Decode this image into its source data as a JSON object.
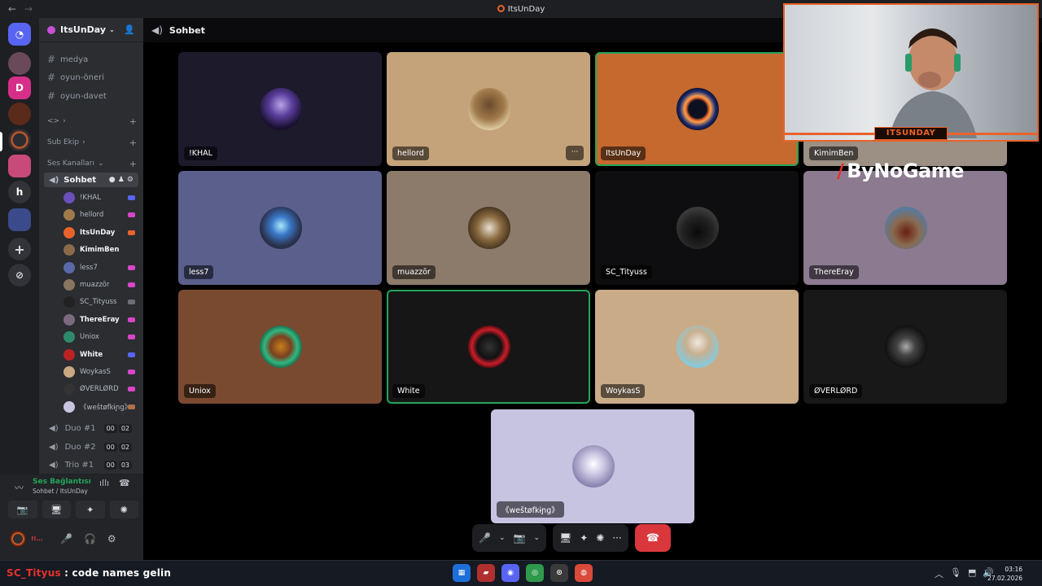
{
  "window": {
    "title": "ItsUnDay",
    "back": "←",
    "forward": "→"
  },
  "guild": {
    "name": "ItsUnDay",
    "chevron": "⌄",
    "invite_icon": "👤"
  },
  "channels": {
    "text": [
      {
        "name": "medya"
      },
      {
        "name": "oyun-öneri"
      },
      {
        "name": "oyun-davet"
      }
    ],
    "collapsed_cat": "<>",
    "sub_ekip": "Sub Ekip",
    "voice_cat": "Ses Kanalları",
    "active_voice": "Sohbet",
    "members": [
      {
        "name": "!KHAL",
        "color": "#6b4fb8",
        "bold": false,
        "tag": "#5865f2"
      },
      {
        "name": "hellord",
        "color": "#a07a4a",
        "bold": false,
        "tag": "#d846c8"
      },
      {
        "name": "ItsUnDay",
        "color": "#e8632a",
        "bold": true,
        "tag": "#e8632a"
      },
      {
        "name": "KimimBen",
        "color": "#8a6a4a",
        "bold": true,
        "tag": ""
      },
      {
        "name": "less7",
        "color": "#5a6aa8",
        "bold": false,
        "tag": "#d846c8"
      },
      {
        "name": "muazzōr",
        "color": "#8a7560",
        "bold": false,
        "tag": "#d846c8"
      },
      {
        "name": "SC_Tityuss",
        "color": "#222",
        "bold": false,
        "tag": "#6d6f78"
      },
      {
        "name": "ThereEray",
        "color": "#7a6a80",
        "bold": true,
        "tag": "#d846c8"
      },
      {
        "name": "Uniox",
        "color": "#2f8a6a",
        "bold": false,
        "tag": "#d846c8"
      },
      {
        "name": "White",
        "color": "#b22",
        "bold": true,
        "tag": "#5865f2"
      },
      {
        "name": "WoykasS",
        "color": "#c9a882",
        "bold": false,
        "tag": "#d846c8"
      },
      {
        "name": "ØVERLØRD",
        "color": "#333",
        "bold": false,
        "tag": "#d846c8"
      },
      {
        "name": "《weštøfkɨɲg》",
        "color": "#c8c4e0",
        "bold": false,
        "tag": "#b0704a"
      }
    ],
    "other_voice": [
      {
        "name": "Duo #1",
        "a": "00",
        "b": "02"
      },
      {
        "name": "Duo #2",
        "a": "00",
        "b": "02"
      },
      {
        "name": "Trio #1",
        "a": "00",
        "b": "03"
      }
    ]
  },
  "voice_panel": {
    "status": "Ses Bağlantısı Kuruldu",
    "location": "Sohbet / ItsUnDay",
    "user": "!!...",
    "buttons": [
      "📷",
      "🖥",
      "✦",
      "✺"
    ]
  },
  "header": {
    "channel": "Sohbet"
  },
  "tiles": [
    {
      "name": "!KHAL",
      "bg": "#1c1a2b",
      "av": "radial-gradient(circle at 50% 40%,#b9a2e8 0%,#5a3e9c 35%,#1a1030 70%)"
    },
    {
      "name": "hellord",
      "bg": "#c5a37a",
      "av": "radial-gradient(circle at 50% 40%,#6a4a2c 0%,#a07a4a 45%,#e8d8b0 80%)"
    },
    {
      "name": "ItsUnDay",
      "bg": "#c5692f",
      "av": "radial-gradient(circle,#0d1020 30%,#e8632a 38%,#f5a050 44%,#1a2a70 60%,#0a0a14 75%)"
    },
    {
      "name": "KimimBen",
      "bg": "#9c8f84",
      "av": "radial-gradient(circle,#555 0%,#333 60%)"
    },
    {
      "name": "less7",
      "bg": "#5a5f8c",
      "av": "radial-gradient(circle at 50% 45%,#a8e8ff 0%,#3a78c8 30%,#2a2f4a 65%)"
    },
    {
      "name": "muazzōr",
      "bg": "#8c7b6a",
      "av": "radial-gradient(circle at 50% 50%,#e8e0d0 0%,#8a6a40 40%,#40301c 75%)"
    },
    {
      "name": "SC_Tityuss",
      "bg": "#0e0e10",
      "av": "radial-gradient(circle at 50% 60%,#0a0a0a 0%,#222 45%,#3a3a3a 70%)"
    },
    {
      "name": "ThereEray",
      "bg": "#8c7a90",
      "av": "radial-gradient(circle at 50% 60%,#6a2010 0%,#8a6a50 40%,#5a7a9a 70%)"
    },
    {
      "name": "Uniox",
      "bg": "#7a4a30",
      "av": "radial-gradient(circle,#c8801a 0%,#7a4020 35%,#2fb880 55%,#1a5a40 75%)"
    },
    {
      "name": "White",
      "bg": "#161616",
      "av": "radial-gradient(circle,#333 0%,#111 40%,#c81e2a 58%,#3a0508 75%)"
    },
    {
      "name": "WoykasS",
      "bg": "#c9ab88",
      "av": "radial-gradient(circle at 50% 40%,#f0e8e0 0%,#c8b090 35%,#8ac8d8 70%)"
    },
    {
      "name": "ØVERLØRD",
      "bg": "#181818",
      "av": "radial-gradient(circle,#aaa 0%,#444 30%,#111 70%)"
    },
    {
      "name": "《weštøfkɨɲg》",
      "bg": "#c7c4e2",
      "av": "radial-gradient(circle at 50% 45%,#ffffff 0%,#c8c4e0 35%,#8a84b0 70%)"
    }
  ],
  "controls": {
    "mic": "🎤",
    "cam": "📷",
    "screen": "🖥",
    "activities": "✦",
    "soundboard": "✺",
    "more": "···",
    "hangup": "☎",
    "popout": "⧉",
    "fullscreen": "⛶"
  },
  "webcam": {
    "brand": "ITSUNDAY"
  },
  "overlay": {
    "sponsor": "ByNoGame"
  },
  "taskbar": {
    "chat_user": "SC_Tityus",
    "chat_message": " : code names gelin",
    "apps": [
      "▦",
      "▰",
      "◉",
      "◎",
      "⊙",
      "◍"
    ],
    "time": "03:16",
    "date": "27.02.2026",
    "tray": [
      "︿",
      "🎙",
      "⬒",
      "🔊"
    ]
  }
}
